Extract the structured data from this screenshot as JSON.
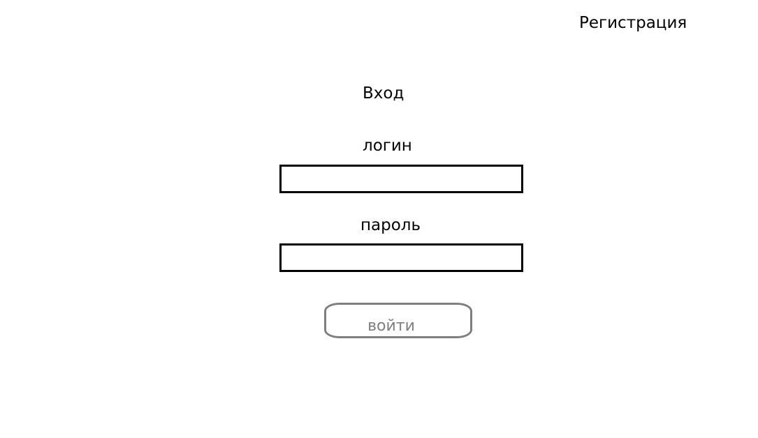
{
  "header": {
    "register_link": "Регистрация"
  },
  "form": {
    "title": "Вход",
    "login_label": "логин",
    "login_value": "",
    "password_label": "пароль",
    "password_value": "",
    "submit_label": "войти"
  },
  "colors": {
    "text": "#000000",
    "field_border": "#000000",
    "button_border": "#7f7f7f",
    "button_text": "#7f7f7f",
    "background": "#ffffff"
  }
}
